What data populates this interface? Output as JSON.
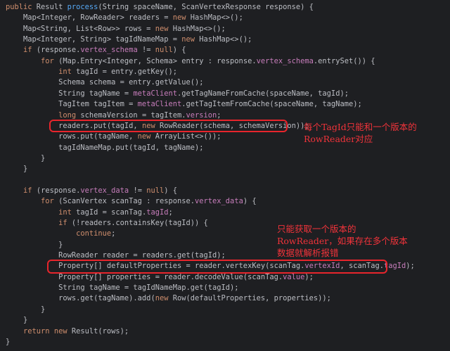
{
  "code_lines": [
    [
      {
        "t": "public ",
        "c": "kw"
      },
      {
        "t": "Result "
      },
      {
        "t": "process",
        "c": "fn"
      },
      {
        "t": "(String spaceName, ScanVertexResponse response) {"
      }
    ],
    [
      {
        "t": "    Map<Integer, RowReader> readers = "
      },
      {
        "t": "new ",
        "c": "kw"
      },
      {
        "t": "HashMap<>();"
      }
    ],
    [
      {
        "t": "    Map<String, List<Row>> rows = "
      },
      {
        "t": "new ",
        "c": "kw"
      },
      {
        "t": "HashMap<>();"
      }
    ],
    [
      {
        "t": "    Map<Integer, String> tagIdNameMap = "
      },
      {
        "t": "new ",
        "c": "kw"
      },
      {
        "t": "HashMap<>();"
      }
    ],
    [
      {
        "t": "    "
      },
      {
        "t": "if ",
        "c": "kw"
      },
      {
        "t": "(response."
      },
      {
        "t": "vertex_schema",
        "c": "fld"
      },
      {
        "t": " != "
      },
      {
        "t": "null",
        "c": "kw"
      },
      {
        "t": ") {"
      }
    ],
    [
      {
        "t": "        "
      },
      {
        "t": "for ",
        "c": "kw"
      },
      {
        "t": "(Map.Entry<Integer, Schema> entry : response."
      },
      {
        "t": "vertex_schema",
        "c": "fld"
      },
      {
        "t": ".entrySet()) {"
      }
    ],
    [
      {
        "t": "            "
      },
      {
        "t": "int ",
        "c": "kw"
      },
      {
        "t": "tagId = entry.getKey();"
      }
    ],
    [
      {
        "t": "            Schema schema = entry.getValue();"
      }
    ],
    [
      {
        "t": "            String tagName = "
      },
      {
        "t": "metaClient",
        "c": "fld"
      },
      {
        "t": ".getTagNameFromCache(spaceName, tagId);"
      }
    ],
    [
      {
        "t": "            TagItem tagItem = "
      },
      {
        "t": "metaClient",
        "c": "fld"
      },
      {
        "t": ".getTagItemFromCache(spaceName, tagName);"
      }
    ],
    [
      {
        "t": "            "
      },
      {
        "t": "long ",
        "c": "kw"
      },
      {
        "t": "schemaVersion = tagItem."
      },
      {
        "t": "version",
        "c": "fld"
      },
      {
        "t": ";"
      }
    ],
    [
      {
        "t": "            readers.put(tagId, "
      },
      {
        "t": "new ",
        "c": "kw"
      },
      {
        "t": "RowReader(schema, schemaVersion));"
      }
    ],
    [
      {
        "t": "            rows.put(tagName, "
      },
      {
        "t": "new ",
        "c": "kw"
      },
      {
        "t": "ArrayList<>());"
      }
    ],
    [
      {
        "t": "            tagIdNameMap.put(tagId, tagName);"
      }
    ],
    [
      {
        "t": "        }"
      }
    ],
    [
      {
        "t": "    }"
      }
    ],
    [
      {
        "t": ""
      }
    ],
    [
      {
        "t": "    "
      },
      {
        "t": "if ",
        "c": "kw"
      },
      {
        "t": "(response."
      },
      {
        "t": "vertex_data",
        "c": "fld"
      },
      {
        "t": " != "
      },
      {
        "t": "null",
        "c": "kw"
      },
      {
        "t": ") {"
      }
    ],
    [
      {
        "t": "        "
      },
      {
        "t": "for ",
        "c": "kw"
      },
      {
        "t": "(ScanVertex scanTag : response."
      },
      {
        "t": "vertex_data",
        "c": "fld"
      },
      {
        "t": ") {"
      }
    ],
    [
      {
        "t": "            "
      },
      {
        "t": "int ",
        "c": "kw"
      },
      {
        "t": "tagId = scanTag."
      },
      {
        "t": "tagId",
        "c": "fld"
      },
      {
        "t": ";"
      }
    ],
    [
      {
        "t": "            "
      },
      {
        "t": "if ",
        "c": "kw"
      },
      {
        "t": "(!readers.containsKey(tagId)) {"
      }
    ],
    [
      {
        "t": "                "
      },
      {
        "t": "continue",
        "c": "kw"
      },
      {
        "t": ";"
      }
    ],
    [
      {
        "t": "            }"
      }
    ],
    [
      {
        "t": "            RowReader reader = readers.get(tagId);"
      }
    ],
    [
      {
        "t": "            Property[] defaultProperties = reader.vertexKey(scanTag."
      },
      {
        "t": "vertexId",
        "c": "fld"
      },
      {
        "t": ", scanTag."
      },
      {
        "t": "tagId",
        "c": "fld"
      },
      {
        "t": ");"
      }
    ],
    [
      {
        "t": "            Property[] properties = reader.decodeValue(scanTag."
      },
      {
        "t": "value",
        "c": "fld"
      },
      {
        "t": ");"
      }
    ],
    [
      {
        "t": "            String tagName = tagIdNameMap.get(tagId);"
      }
    ],
    [
      {
        "t": "            rows.get(tagName).add("
      },
      {
        "t": "new ",
        "c": "kw"
      },
      {
        "t": "Row(defaultProperties, properties));"
      }
    ],
    [
      {
        "t": "        }"
      }
    ],
    [
      {
        "t": "    }"
      }
    ],
    [
      {
        "t": "    "
      },
      {
        "t": "return new ",
        "c": "kw"
      },
      {
        "t": "Result(rows);"
      }
    ],
    [
      {
        "t": "}"
      }
    ]
  ],
  "annotations": {
    "readers_note": "每个TagId只能和一个版本的\nRowReader对应",
    "decode_note": "只能获取一个版本的\nRowReader，如果存在多个版本\n数据就解析报错"
  },
  "colors": {
    "background": "#1e1f22",
    "text": "#bcbec4",
    "keyword": "#cf8e6d",
    "method": "#56a8f5",
    "field": "#c77dbb",
    "highlight": "#e8252c"
  }
}
